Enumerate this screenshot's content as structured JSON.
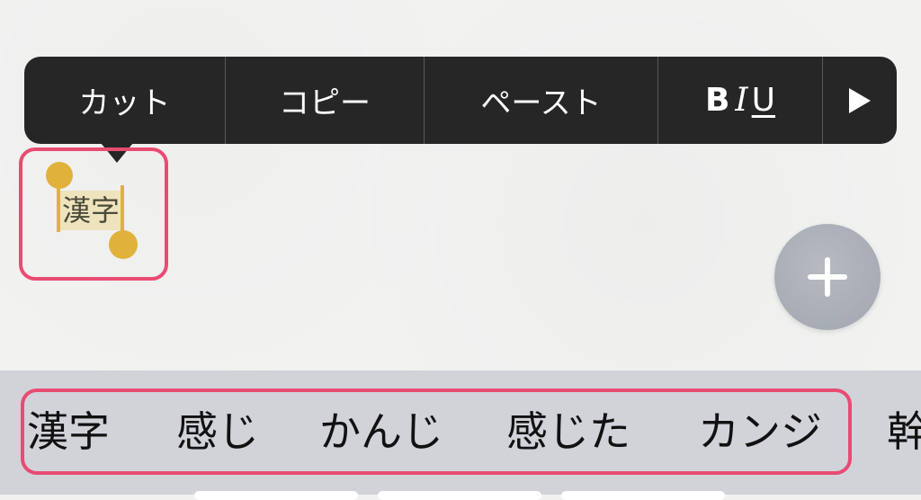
{
  "edit_menu": {
    "cut": "カット",
    "copy": "コピー",
    "paste": "ペースト",
    "format": {
      "bold": "B",
      "italic": "I",
      "underline": "U"
    },
    "more_icon": "play-right-icon"
  },
  "document": {
    "selected_text": "漢字"
  },
  "add_button": {
    "icon": "plus-icon"
  },
  "candidates": [
    "漢字",
    "感じ",
    "かんじ",
    "感じた",
    "カンジ",
    "幹"
  ],
  "colors": {
    "menu_bg": "#262626",
    "highlight_border": "#e94b72",
    "selection_handle": "#e0b23c",
    "selection_fill": "#eee3bd",
    "candidate_bar_bg": "#d1d3d9",
    "fab_bg": "#aab0b8"
  }
}
